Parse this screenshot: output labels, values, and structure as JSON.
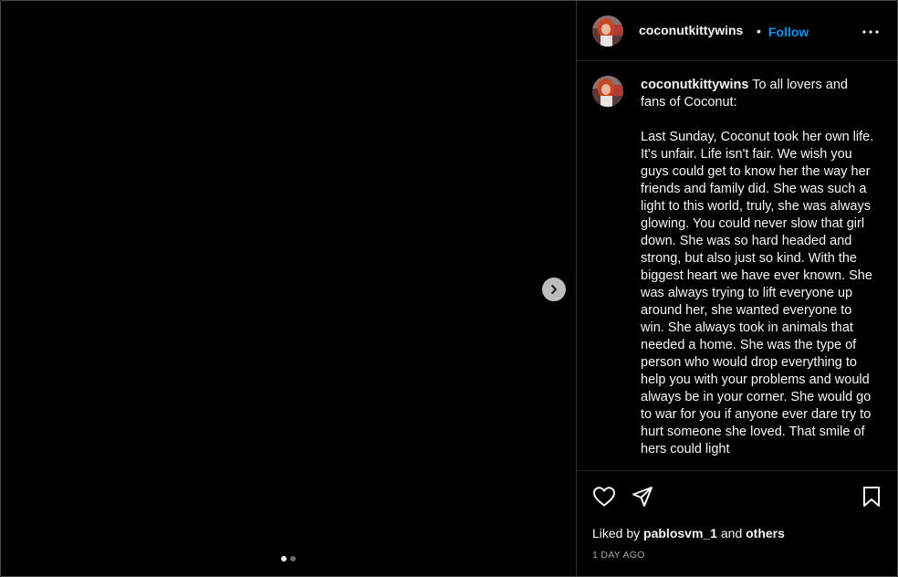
{
  "post": {
    "username": "coconutkittywins",
    "follow_label": "Follow",
    "separator": "•",
    "caption_user": "coconutkittywins",
    "caption_text": " To all lovers and fans of Coconut:\n\nLast Sunday, Coconut took her own life. It's unfair. Life isn't fair. We wish you guys could get to know her the way her friends and family did. She was such a light to this world, truly, she was always glowing. You could never slow that girl down. She was so hard headed and strong, but also just so kind. With the biggest heart we have ever known. She was always trying to lift everyone up around her, she wanted everyone to win. She always took in animals that needed a home. She was the type of person who would drop everything to help you with your problems and would always be in your corner. She would go to war for you if anyone ever dare try to hurt someone she loved. That smile of hers could light",
    "liked_by_prefix": "Liked by ",
    "liked_by_user": "pablosvm_1",
    "liked_by_and": " and ",
    "liked_by_others": "others",
    "timestamp": "1 DAY AGO"
  },
  "carousel": {
    "total": 2,
    "active_index": 0
  },
  "icons": {
    "next": "chevron-right-icon",
    "more": "more-options-icon",
    "like": "heart-icon",
    "share": "send-icon",
    "save": "bookmark-icon"
  },
  "colors": {
    "background": "#000000",
    "follow": "#0095f6",
    "text": "#f5f5f5",
    "muted": "#a8a8a8"
  }
}
